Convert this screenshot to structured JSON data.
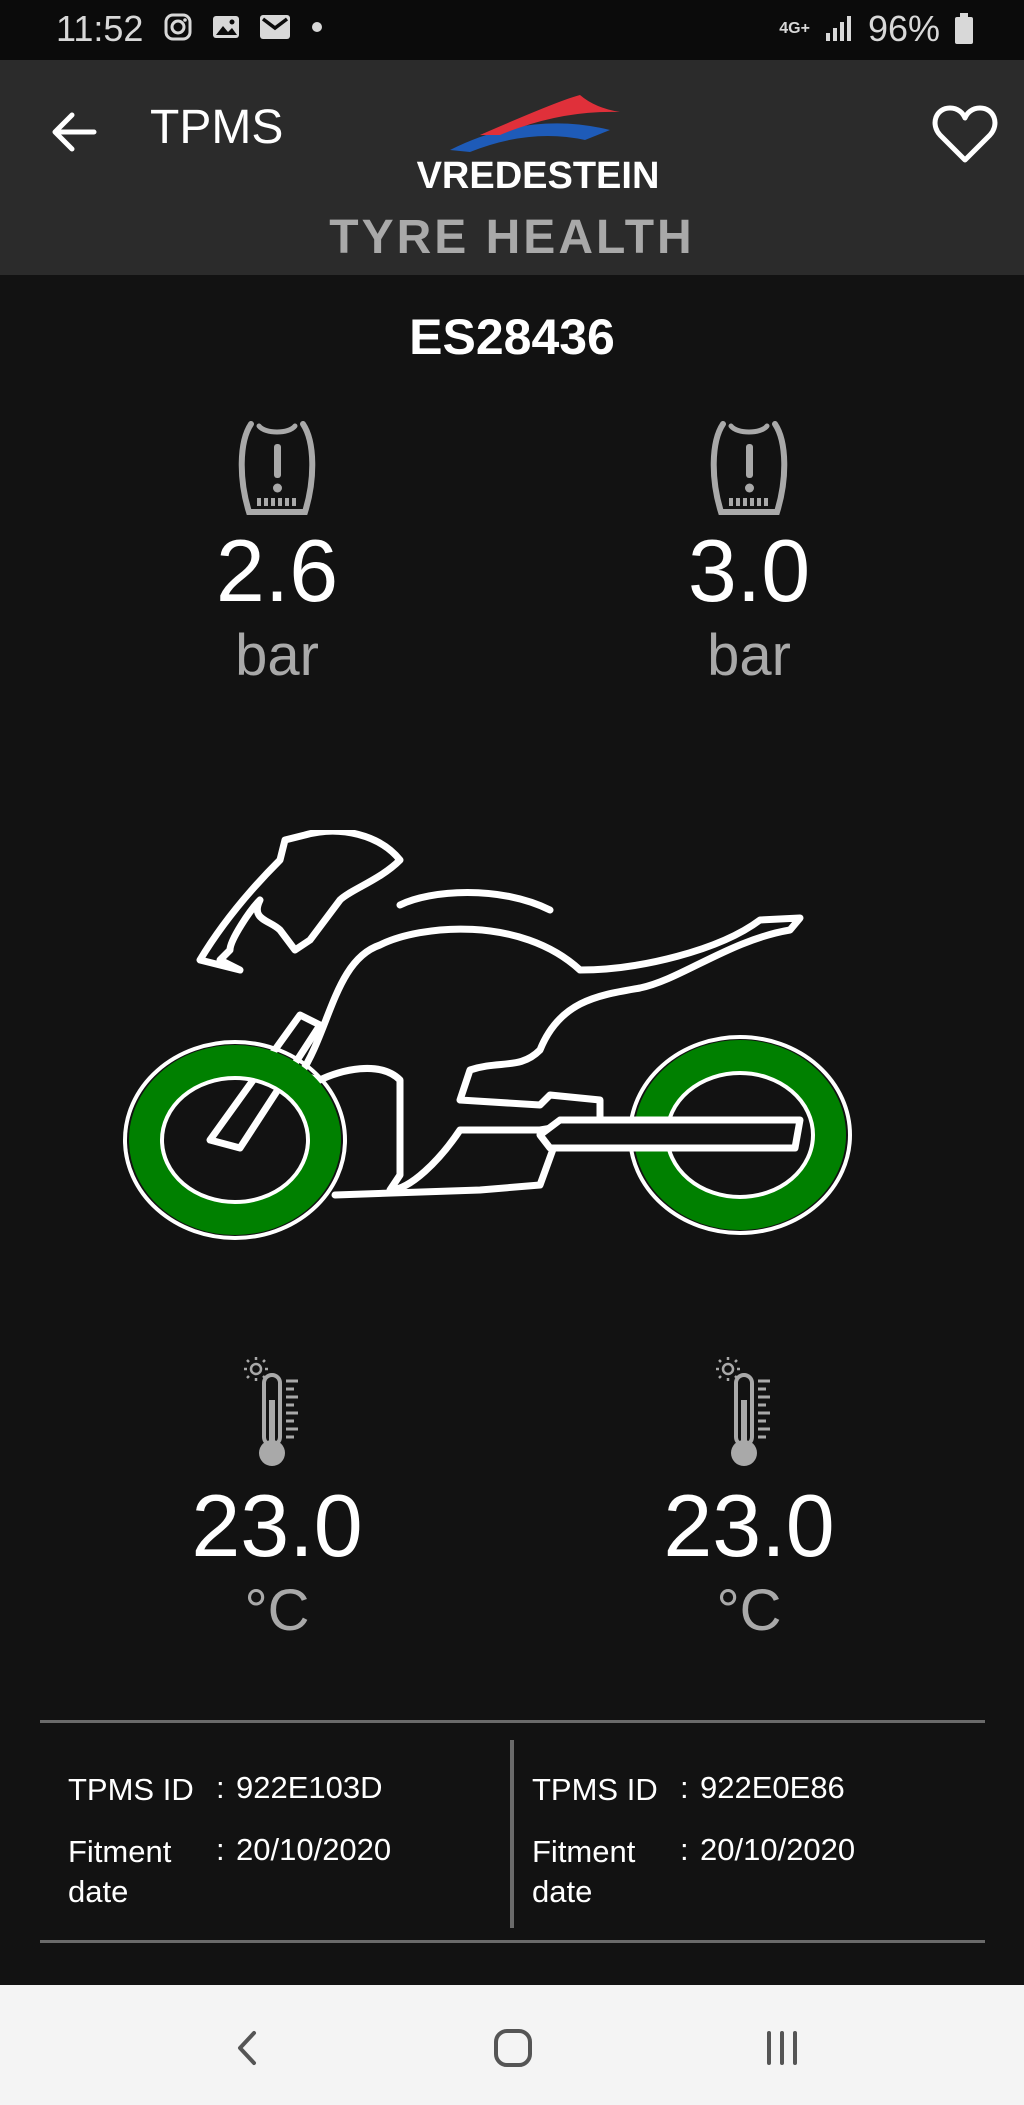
{
  "status_bar": {
    "time": "11:52",
    "notification_icons": [
      "instagram-icon",
      "gallery-icon",
      "gmail-icon",
      "dot-icon"
    ],
    "network": "4G+",
    "battery": "96%"
  },
  "toolbar": {
    "title": "TPMS",
    "brand": "VREDESTEIN",
    "section_title": "TYRE HEALTH"
  },
  "vehicle": {
    "id": "ES28436"
  },
  "front": {
    "pressure": "2.6",
    "pressure_unit": "bar",
    "temperature": "23.0",
    "temperature_unit": "°C",
    "tpms_id_label": "TPMS ID",
    "tpms_id": "922E103D",
    "fitment_label_1": "Fitment",
    "fitment_label_2": "date",
    "fitment_date": "20/10/2020"
  },
  "rear": {
    "pressure": "3.0",
    "pressure_unit": "bar",
    "temperature": "23.0",
    "temperature_unit": "°C",
    "tpms_id_label": "TPMS ID",
    "tpms_id": "922E0E86",
    "fitment_label_1": "Fitment",
    "fitment_label_2": "date",
    "fitment_date": "20/10/2020"
  },
  "colors": {
    "tyre_ok": "#008000",
    "toolbar_bg": "#2b2b2b",
    "background": "#121212",
    "brand_red": "#e0303a",
    "brand_blue": "#1e5bb8"
  }
}
